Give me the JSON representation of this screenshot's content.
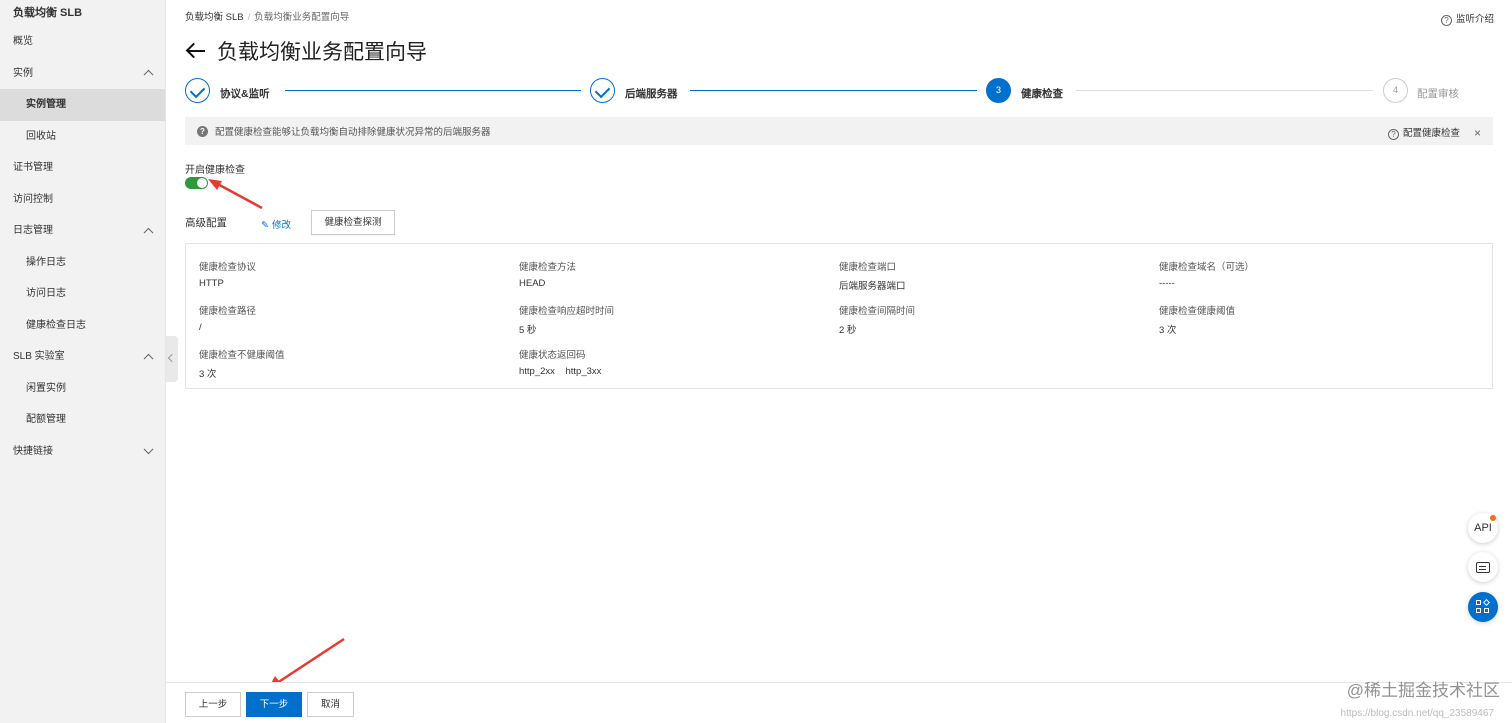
{
  "sidebar": {
    "title": "负载均衡 SLB",
    "items": [
      {
        "label": "概览"
      },
      {
        "label": "实例"
      },
      {
        "label": "实例管理"
      },
      {
        "label": "回收站"
      },
      {
        "label": "证书管理"
      },
      {
        "label": "访问控制"
      },
      {
        "label": "日志管理"
      },
      {
        "label": "操作日志"
      },
      {
        "label": "访问日志"
      },
      {
        "label": "健康检查日志"
      },
      {
        "label": "SLB 实验室"
      },
      {
        "label": "闲置实例"
      },
      {
        "label": "配额管理"
      },
      {
        "label": "快捷链接"
      }
    ]
  },
  "breadcrumb": {
    "first": "负载均衡 SLB",
    "sep": "/",
    "second": "负载均衡业务配置向导"
  },
  "help_link": "监听介绍",
  "page_title": "负载均衡业务配置向导",
  "steps": [
    {
      "label": "协议&监听",
      "state": "done"
    },
    {
      "label": "后端服务器",
      "state": "done"
    },
    {
      "num": "3",
      "label": "健康检查",
      "state": "current"
    },
    {
      "num": "4",
      "label": "配置审核",
      "state": "todo"
    }
  ],
  "banner": {
    "text": "配置健康检查能够让负载均衡自动排除健康状况异常的后端服务器",
    "help": "配置健康检查",
    "close": "×"
  },
  "toggle": {
    "label": "开启健康检查",
    "on": true
  },
  "advanced": {
    "label": "高级配置",
    "edit": "修改",
    "probe_button": "健康检查探测"
  },
  "config": {
    "protocol": {
      "key": "健康检查协议",
      "value": "HTTP"
    },
    "method": {
      "key": "健康检查方法",
      "value": "HEAD"
    },
    "port": {
      "key": "健康检查端口",
      "value": "后端服务器端口"
    },
    "domain": {
      "key": "健康检查域名（可选）",
      "value": "-----"
    },
    "path": {
      "key": "健康检查路径",
      "value": "/"
    },
    "timeout": {
      "key": "健康检查响应超时时间",
      "value": "5 秒"
    },
    "interval": {
      "key": "健康检查间隔时间",
      "value": "2 秒"
    },
    "healthy": {
      "key": "健康检查健康阈值",
      "value": "3 次"
    },
    "unhealthy": {
      "key": "健康检查不健康阈值",
      "value": "3 次"
    },
    "codes": {
      "key": "健康状态返回码",
      "value": "http_2xx    http_3xx"
    }
  },
  "fabs": {
    "api": "API"
  },
  "footer": {
    "prev": "上一步",
    "next": "下一步",
    "cancel": "取消"
  },
  "watermark": "@稀土掘金技术社区",
  "watermark_url": "https://blog.csdn.net/qq_23589467",
  "colors": {
    "primary": "#0070cc",
    "toggle_on": "#2a9a3a",
    "annotation": "#e8392f"
  }
}
